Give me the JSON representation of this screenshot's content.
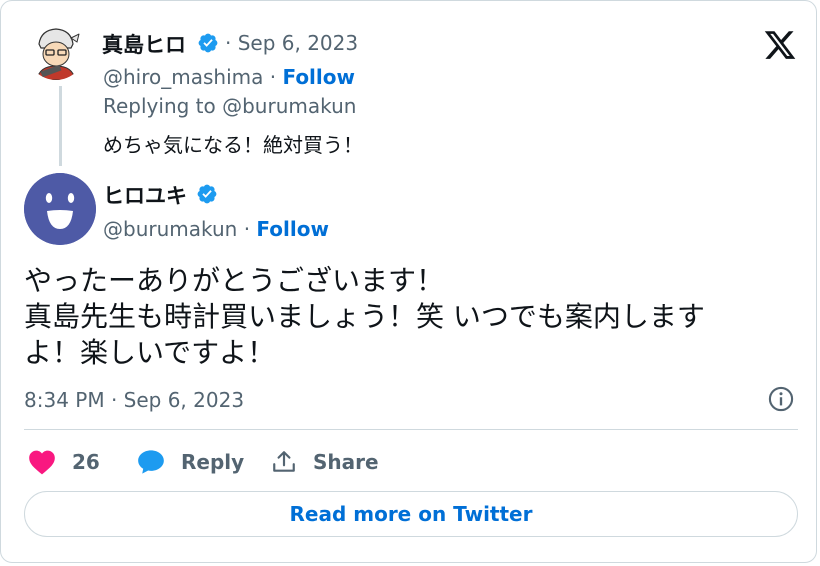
{
  "reply_tweet": {
    "author_name": "真島ヒロ",
    "date": "· Sep 6, 2023",
    "handle": "@hiro_mashima",
    "separator": "·",
    "follow_label": "Follow",
    "replying_to": "Replying to @burumakun",
    "text": "めちゃ気になる！絶対買う！"
  },
  "main_tweet": {
    "author_name": "ヒロユキ",
    "handle": "@burumakun",
    "separator": "·",
    "follow_label": "Follow",
    "text": "やったーありがとうございます！\n真島先生も時計買いましょう！笑 いつでも案内します\nよ！楽しいですよ！",
    "timestamp": "8:34 PM · Sep 6, 2023"
  },
  "actions": {
    "like_count": "26",
    "reply_label": "Reply",
    "share_label": "Share"
  },
  "read_more_label": "Read more on Twitter",
  "icons": {
    "verified": "verified-badge-icon",
    "like": "heart-icon",
    "reply": "speech-bubble-icon",
    "share": "share-upload-icon",
    "info": "info-icon",
    "logo": "x-logo-icon"
  },
  "colors": {
    "link": "#006fd6",
    "verified": "#1d9bf0",
    "like": "#f91880",
    "secondary_text": "#536471"
  }
}
